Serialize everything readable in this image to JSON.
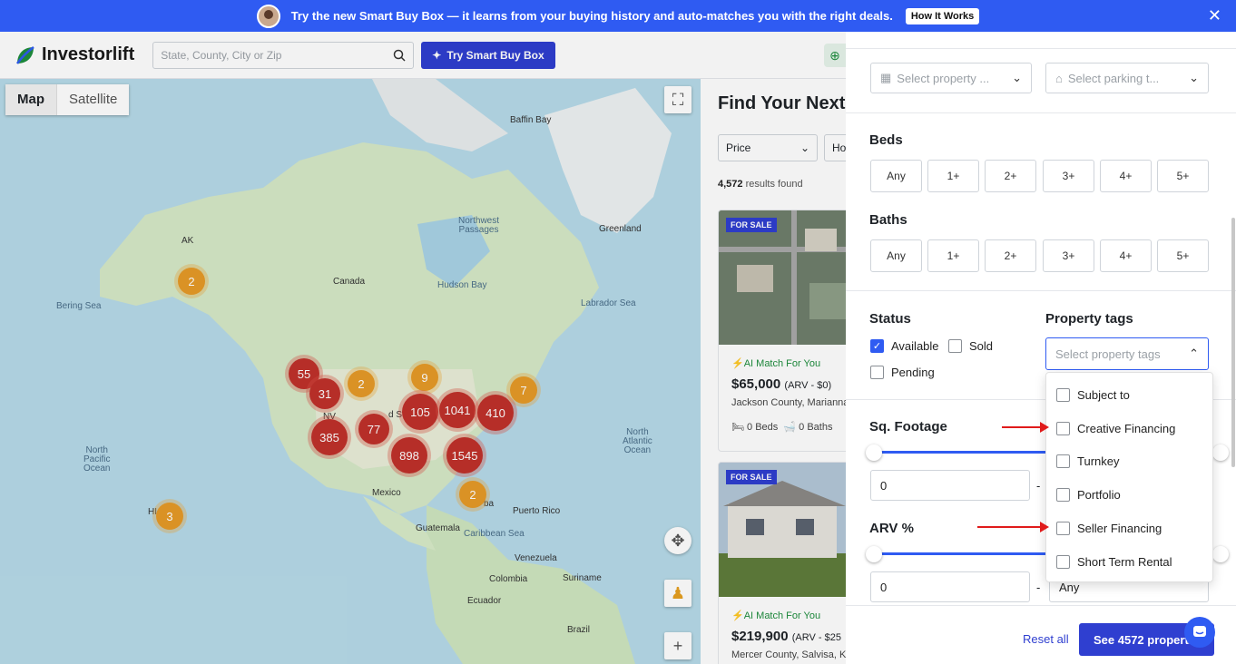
{
  "banner": {
    "message": "Try the new Smart Buy Box — it learns from your buying history and auto-matches you with the right deals.",
    "cta": "How It Works",
    "close": "✕"
  },
  "header": {
    "logo": "Investorlift",
    "search_placeholder": "State, County, City or Zip",
    "smart_btn": "Try Smart Buy Box"
  },
  "map": {
    "type_map": "Map",
    "type_satellite": "Satellite",
    "labels": {
      "baffin_bay": "Baffin Bay",
      "ak": "AK",
      "northwest_passages": "Northwest\nPassages",
      "greenland": "Greenland",
      "bering_sea": "Bering Sea",
      "canada": "Canada",
      "hudson_bay": "Hudson Bay",
      "labrador_sea": "Labrador Sea",
      "north_pacific": "North\nPacific\nOcean",
      "north_atlantic": "North\nAtlantic\nOcean",
      "nv": "NV",
      "mexico": "Mexico",
      "guatemala": "Guatemala",
      "caribbean_sea": "Caribbean Sea",
      "puerto_rico": "Puerto Rico",
      "venezuela": "Venezuela",
      "colombia": "Colombia",
      "suriname": "Suriname",
      "ecuador": "Ecuador",
      "brazil": "Brazil",
      "hi": "HI",
      "united_st": "d St",
      "cuba": "ba"
    },
    "clusters": [
      "2",
      "55",
      "31",
      "2",
      "9",
      "7",
      "105",
      "1041",
      "410",
      "385",
      "77",
      "898",
      "1545",
      "2",
      "3"
    ]
  },
  "list": {
    "title": "Find Your Next",
    "price_filter": "Price",
    "home_filter": "Ho",
    "count_num": "4,572",
    "count_text": "results found",
    "cards": [
      {
        "badge": "FOR SALE",
        "ai": "AI Match For You",
        "price": "$65,000",
        "arv": "(ARV - $0)",
        "location": "Jackson County, Marianna",
        "beds": "0 Beds",
        "baths": "0 Baths"
      },
      {
        "badge": "FOR SALE",
        "ai": "AI Match For You",
        "price": "$219,900",
        "arv": "(ARV - $25",
        "location": "Mercer County, Salvisa, K"
      }
    ]
  },
  "panel": {
    "property_type_placeholder": "Select property ...",
    "parking_placeholder": "Select parking t...",
    "beds_title": "Beds",
    "baths_title": "Baths",
    "bed_options": [
      "Any",
      "1+",
      "2+",
      "3+",
      "4+",
      "5+"
    ],
    "bath_options": [
      "Any",
      "1+",
      "2+",
      "3+",
      "4+",
      "5+"
    ],
    "status_title": "Status",
    "status_available": "Available",
    "status_sold": "Sold",
    "status_pending": "Pending",
    "tags_title": "Property tags",
    "tags_placeholder": "Select property tags",
    "sqft_title": "Sq. Footage",
    "sqft_min": "0",
    "arv_title": "ARV %",
    "arv_min": "0",
    "arv_max": "Any",
    "dash": "-",
    "tag_options": [
      "Subject to",
      "Creative Financing",
      "Turnkey",
      "Portfolio",
      "Seller Financing",
      "Short Term Rental"
    ]
  },
  "footer": {
    "reset": "Reset all",
    "see": "See 4572 properties"
  },
  "colors": {
    "accent": "#2f3fd0",
    "banner": "#2f5bf2",
    "cluster_red": "#c0312b",
    "cluster_orange": "#e69a28"
  }
}
